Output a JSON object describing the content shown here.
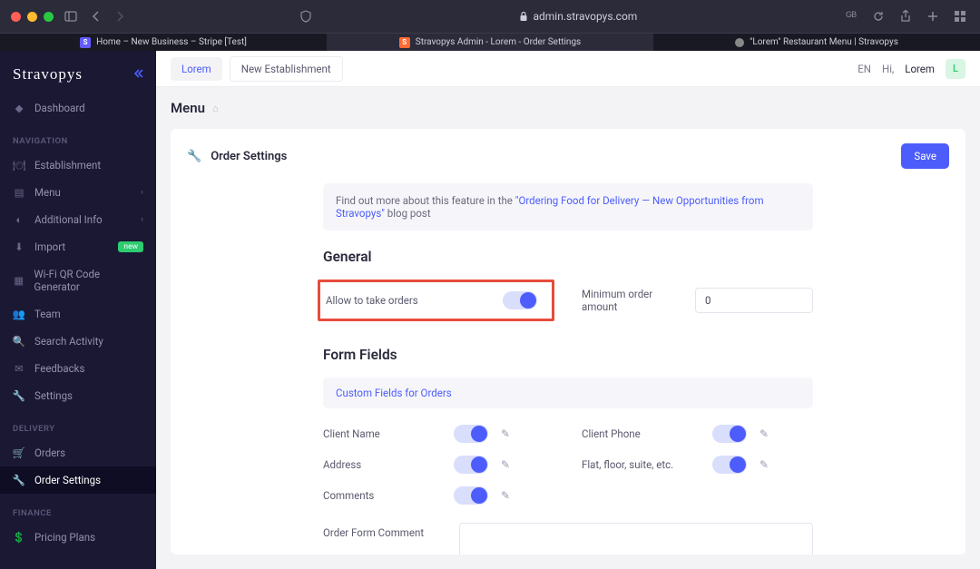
{
  "browser": {
    "address": "admin.stravopys.com",
    "tabs": [
      {
        "label": "Home – New Business – Stripe [Test]",
        "favicon": "S"
      },
      {
        "label": "Stravopys Admin - Lorem - Order Settings",
        "favicon": "S"
      },
      {
        "label": "\"Lorem\" Restaurant Menu | Stravopys",
        "favicon": "•"
      }
    ]
  },
  "sidebar": {
    "logo": "Stravopys",
    "dashboard": "Dashboard",
    "headers": {
      "navigation": "NAVIGATION",
      "delivery": "DELIVERY",
      "finance": "FINANCE"
    },
    "items": {
      "establishment": "Establishment",
      "menu": "Menu",
      "additional_info": "Additional Info",
      "import": "Import",
      "import_badge": "new",
      "wifi_qr": "Wi-Fi QR Code Generator",
      "team": "Team",
      "search_activity": "Search Activity",
      "feedbacks": "Feedbacks",
      "settings": "Settings",
      "orders": "Orders",
      "order_settings": "Order Settings",
      "pricing_plans": "Pricing Plans"
    }
  },
  "topbar": {
    "tab_est": "Lorem",
    "tab_new": "New Establishment",
    "lang": "EN",
    "greeting": "Hi,",
    "user": "Lorem",
    "avatar": "L"
  },
  "page": {
    "title": "Menu",
    "card_title": "Order Settings",
    "save": "Save",
    "info_prefix": "Find out more about this feature in the ",
    "info_link": "\"Ordering Food for Delivery — New Opportunities from Stravopys\"",
    "info_suffix": " blog post",
    "general_heading": "General",
    "allow_orders_label": "Allow to take orders",
    "min_order_label": "Minimum order amount",
    "min_order_value": "0",
    "form_fields_heading": "Form Fields",
    "custom_fields": "Custom Fields for Orders",
    "fields": {
      "client_name": "Client Name",
      "client_phone": "Client Phone",
      "address": "Address",
      "flat": "Flat, floor, suite, etc.",
      "comments": "Comments"
    },
    "order_form_comment": "Order Form Comment"
  }
}
